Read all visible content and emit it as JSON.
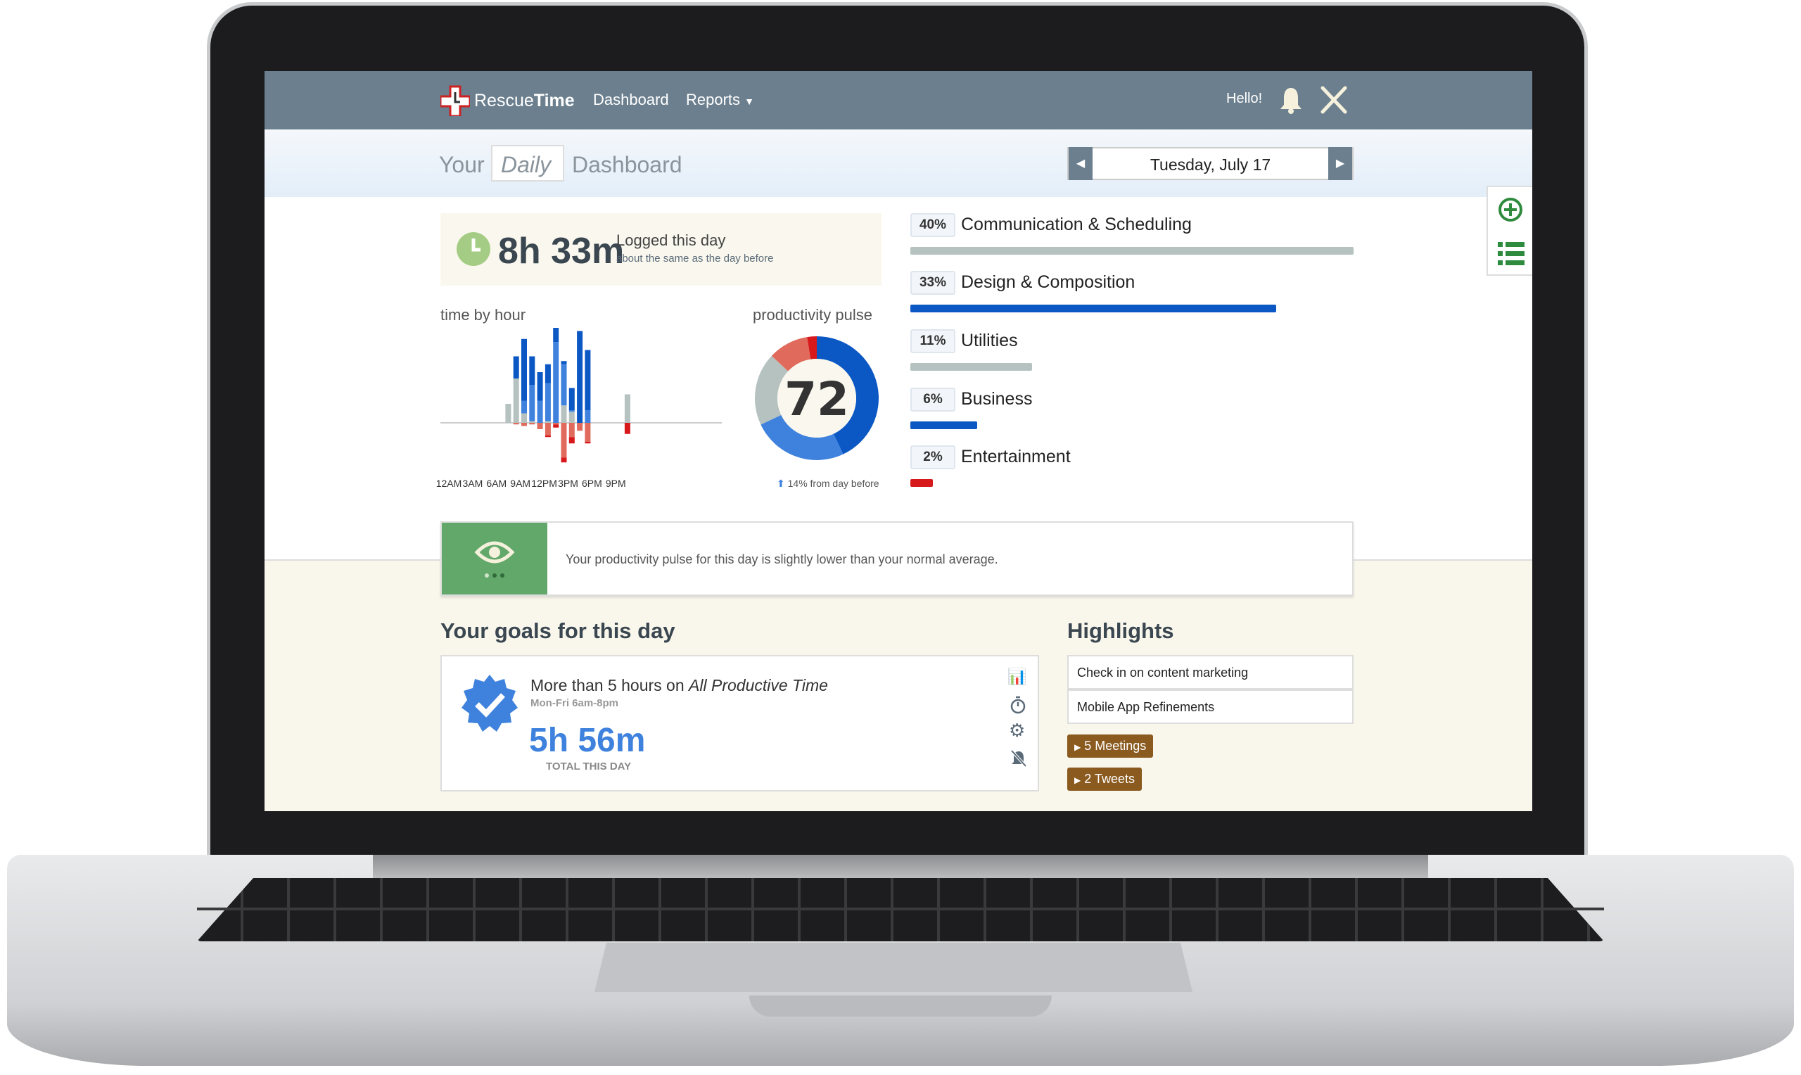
{
  "nav": {
    "brand_a": "Rescue",
    "brand_b": "Time",
    "dashboard": "Dashboard",
    "reports": "Reports",
    "hello": "Hello!",
    "icons": [
      "rescuetime-logo",
      "bell-icon",
      "tools-icon",
      "caret-down-icon"
    ]
  },
  "subheader": {
    "your": "Your",
    "period": "Daily",
    "dashboard": "Dashboard",
    "date": "Tuesday, July 17"
  },
  "side_buttons": [
    "plus-circle-icon",
    "list-icon"
  ],
  "logged": {
    "time": "8h 33m",
    "label": "Logged this day",
    "sub": "about the same as the day before"
  },
  "time_by_hour": {
    "title": "time by hour",
    "ticks": [
      "12AM",
      "3AM",
      "6AM",
      "9AM",
      "12PM",
      "3PM",
      "6PM",
      "9PM"
    ]
  },
  "pulse": {
    "title": "productivity pulse",
    "score": "72",
    "change": "14% from day before"
  },
  "colors": {
    "very_productive": "#0b57c4",
    "productive": "#3f82de",
    "neutral": "#b5c2c0",
    "distracting": "#e06a5c",
    "very_distracting": "#d7191c",
    "nav": "#6b7f8e",
    "highlight_button": "#8a5a1f",
    "insight_green": "#63a86b"
  },
  "chart_data": [
    {
      "type": "bar",
      "title": "time by hour",
      "stacked": true,
      "unit": "minutes (estimated)",
      "categories": [
        "8AM",
        "9AM",
        "10AM",
        "11AM",
        "12PM",
        "1PM",
        "2PM",
        "3PM",
        "4PM",
        "5PM",
        "6PM",
        "11PM"
      ],
      "series": [
        {
          "key": "very_productive",
          "values": [
            0,
            14,
            39,
            18,
            18,
            12,
            9,
            2,
            14,
            58,
            38,
            0
          ]
        },
        {
          "key": "productive",
          "values": [
            0,
            0,
            8,
            23,
            14,
            24,
            51,
            26,
            1,
            0,
            8,
            0
          ]
        },
        {
          "key": "neutral",
          "values": [
            12,
            28,
            6,
            1,
            0,
            1,
            0,
            11,
            7,
            0,
            0,
            18
          ]
        },
        {
          "key": "distracting",
          "values": [
            0,
            1,
            2,
            1,
            4,
            8,
            1,
            22,
            9,
            5,
            12,
            0
          ]
        },
        {
          "key": "very_distracting",
          "values": [
            0,
            0,
            0,
            0,
            0,
            1,
            2,
            3,
            4,
            0,
            1,
            7
          ]
        }
      ]
    },
    {
      "type": "pie",
      "title": "productivity pulse",
      "donut": true,
      "categories": [
        "very_productive",
        "productive",
        "neutral",
        "distracting",
        "very_distracting"
      ],
      "values": [
        43,
        25,
        19,
        10.5,
        2.5
      ]
    }
  ],
  "categories": [
    {
      "pct": "40%",
      "name": "Communication & Scheduling",
      "value": 40,
      "color": "#b5c2c0"
    },
    {
      "pct": "33%",
      "name": "Design & Composition",
      "value": 33,
      "color": "#0b57c4"
    },
    {
      "pct": "11%",
      "name": "Utilities",
      "value": 11,
      "color": "#b5c2c0"
    },
    {
      "pct": "6%",
      "name": "Business",
      "value": 6,
      "color": "#0b57c4"
    },
    {
      "pct": "2%",
      "name": "Entertainment",
      "value": 2,
      "color": "#d7191c"
    }
  ],
  "insight": {
    "text": "Your productivity pulse for this day is slightly lower than your normal average.",
    "icon": "eye-icon"
  },
  "goals": {
    "title": "Your goals for this day",
    "goal_prefix": "More than 5 hours on ",
    "goal_target": "All Productive Time",
    "schedule": "Mon-Fri 6am-8pm",
    "total": "5h 56m",
    "total_label": "TOTAL THIS DAY",
    "icons": [
      "verified-badge-icon",
      "chart-icon",
      "stopwatch-icon",
      "gear-icon",
      "bell-off-icon"
    ]
  },
  "highlights": {
    "title": "Highlights",
    "items": [
      "Check in on content marketing",
      "Mobile App Refinements"
    ],
    "buttons": [
      "5 Meetings",
      "2 Tweets"
    ]
  }
}
